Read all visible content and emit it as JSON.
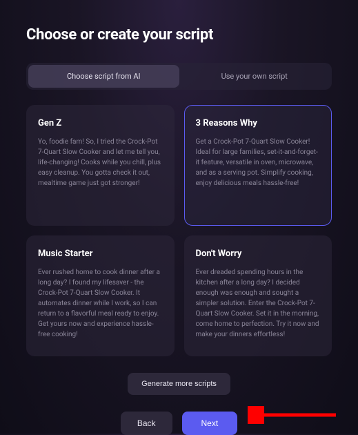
{
  "header": {
    "title": "Choose or create your script"
  },
  "tabs": {
    "choose": "Choose script from AI",
    "own": "Use your own script"
  },
  "cards": [
    {
      "title": "Gen Z",
      "body": "Yo, foodie fam! So, I tried the Crock-Pot 7-Quart Slow Cooker and let me tell you, life-changing! Cooks while you chill, plus easy cleanup. You gotta check it out, mealtime game just got stronger!",
      "selected": false
    },
    {
      "title": "3 Reasons Why",
      "body": "Get a Crock-Pot 7-Quart Slow Cooker! Ideal for large families, set-it-and-forget-it feature, versatile in oven, microwave, and as a serving pot. Simplify cooking, enjoy delicious meals hassle-free!",
      "selected": true
    },
    {
      "title": "Music Starter",
      "body": "Ever rushed home to cook dinner after a long day? I found my lifesaver - the Crock-Pot 7-Quart Slow Cooker. It automates dinner while I work, so I can return to a flavorful meal ready to enjoy. Get yours now and experience hassle-free cooking!",
      "selected": false
    },
    {
      "title": "Don't Worry",
      "body": "Ever dreaded spending hours in the kitchen after a long day? I decided enough was enough and sought a simpler solution. Enter the Crock-Pot 7-Quart Slow Cooker. Set it in the morning, come home to perfection. Try it now and make your dinners effortless!",
      "selected": false
    }
  ],
  "buttons": {
    "generate": "Generate more scripts",
    "back": "Back",
    "next": "Next"
  },
  "annotation": {
    "arrow_color": "#ff0000"
  }
}
